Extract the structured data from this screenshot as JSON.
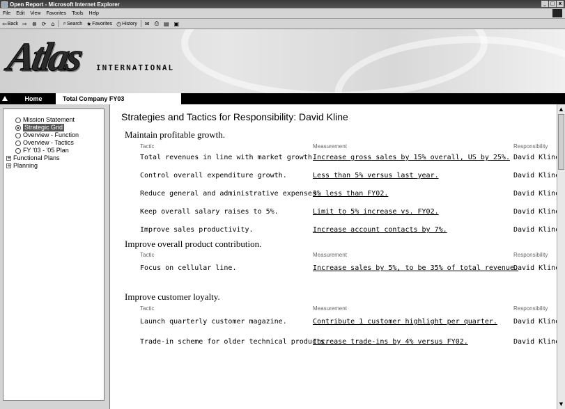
{
  "window": {
    "title": "Open Report - Microsoft Internet Explorer",
    "controls": [
      "_",
      "□",
      "x"
    ]
  },
  "menu": [
    "File",
    "Edit",
    "View",
    "Favorites",
    "Tools",
    "Help"
  ],
  "toolbar": {
    "back": "Back",
    "search": "Search",
    "favorites": "Favorites",
    "history": "History"
  },
  "banner": {
    "logo": "Atlas",
    "subtitle": "INTERNATIONAL"
  },
  "nav": {
    "home": "Home",
    "active_tab": "Total Company FY03"
  },
  "tree": {
    "items": [
      {
        "label": "Mission Statement",
        "type": "radio",
        "selected": false
      },
      {
        "label": "Strategic Grid",
        "type": "radio",
        "selected": true
      },
      {
        "label": "Overview - Function",
        "type": "radio",
        "selected": false
      },
      {
        "label": "Overview - Tactics",
        "type": "radio",
        "selected": false
      },
      {
        "label": "FY '03 - '05 Plan",
        "type": "radio",
        "selected": false
      },
      {
        "label": "Functional Plans",
        "type": "folder",
        "selected": false
      },
      {
        "label": "Planning",
        "type": "folder",
        "selected": false
      }
    ]
  },
  "report": {
    "title": "Strategies and Tactics for Responsibility: David Kline",
    "col_tactic": "Tactic",
    "col_measurement": "Measurement",
    "col_responsibility": "Responsibility",
    "sections": [
      {
        "heading": "Maintain profitable growth.",
        "rows": [
          {
            "tactic": "Total revenues in line with market growth.",
            "measurement": "Increase gross sales by 15% overall, US by 25%.",
            "responsibility": "David Kline"
          },
          {
            "tactic": "Control overall expenditure growth.",
            "measurement": "Less than 5% versus last year.",
            "responsibility": "David Kline"
          },
          {
            "tactic": "Reduce general and administrative expenses.",
            "measurement": "3% less than FY02.",
            "responsibility": "David Kline"
          },
          {
            "tactic": "Keep overall salary raises to 5%.",
            "measurement": "Limit to 5% increase vs. FY02.",
            "responsibility": "David Kline"
          },
          {
            "tactic": "Improve sales productivity.",
            "measurement": "Increase account contacts by 7%.",
            "responsibility": "David Kline"
          }
        ]
      },
      {
        "heading": "Improve overall product contribution.",
        "rows": [
          {
            "tactic": "Focus on cellular line.",
            "measurement": "Increase sales by 5%, to be 35% of total revenue.",
            "responsibility": "David Kline"
          }
        ]
      },
      {
        "heading": "Improve customer loyalty.",
        "rows": [
          {
            "tactic": "Launch quarterly customer magazine.",
            "measurement": "Contribute 1 customer highlight per quarter.",
            "responsibility": "David Kline"
          },
          {
            "tactic": "Trade-in scheme for older technical products.",
            "measurement": "Increase trade-ins by 4% versus FY02.",
            "responsibility": "David Kline"
          }
        ]
      }
    ]
  }
}
